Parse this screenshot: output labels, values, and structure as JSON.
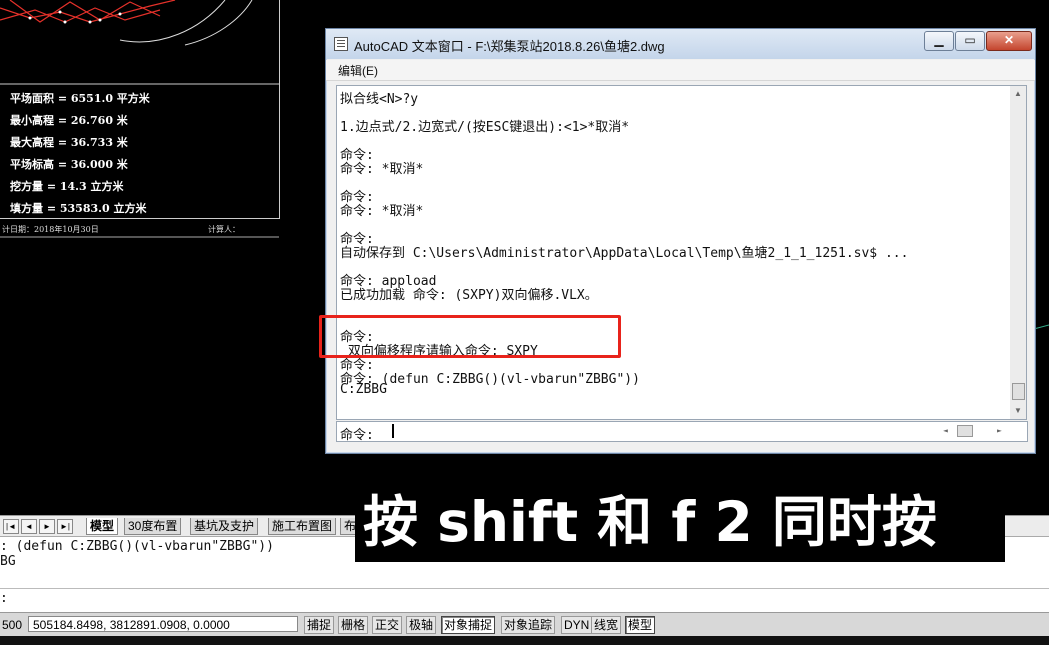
{
  "drawing": {
    "info_lines": [
      "平场面积 = 6551.0 平方米",
      "最小高程 = 26.760 米",
      "最大高程 = 36.733 米",
      "平场标高 = 36.000 米",
      "挖方量 = 14.3 立方米",
      "填方量 = 53583.0 立方米"
    ],
    "date_label": "计日期：2018年10月30日",
    "calc_label": "计算人："
  },
  "text_window": {
    "title": "AutoCAD 文本窗口 - F:\\郑集泵站2018.8.26\\鱼塘2.dwg",
    "menu_edit": "编辑(E)",
    "buttons": {
      "minimize": "▁",
      "maximize": "▭",
      "close": "✕"
    },
    "lines": [
      "拟合线<N>?y",
      "1.边点式/2.边宽式/(按ESC键退出):<1>*取消*",
      "命令:",
      "命令: *取消*",
      "命令:",
      "命令: *取消*",
      "命令:",
      "自动保存到 C:\\Users\\Administrator\\AppData\\Local\\Temp\\鱼塘2_1_1_1251.sv$ ...",
      "命令: appload",
      "已成功加载 命令: (SXPY)双向偏移.VLX。",
      "命令:",
      " 双向偏移程序请输入命令: SXPY",
      "命令:",
      "命令: (defun C:ZBBG()(vl-vbarun\"ZBBG\"))",
      "C:ZBBG"
    ],
    "command_prompt": "命令:"
  },
  "layout_tabs": [
    "模型",
    "30度布置",
    "基坑及支护",
    "施工布置图",
    "布"
  ],
  "subtitle": "按 shift 和 f 2 同时按",
  "command_history": [
    ": (defun C:ZBBG()(vl-vbarun\"ZBBG\"))",
    "BG",
    ":"
  ],
  "status_bar": {
    "scale": "500",
    "coordinates": "505184.8498, 3812891.0908, 0.0000",
    "toggles": [
      "捕捉",
      "栅格",
      "正交",
      "极轴",
      "对象捕捉",
      "对象追踪",
      "DYN",
      "线宽",
      "模型"
    ],
    "active": [
      "对象捕捉",
      "模型"
    ]
  }
}
